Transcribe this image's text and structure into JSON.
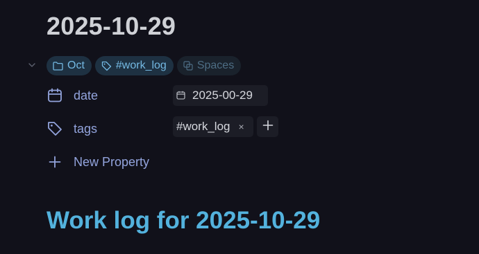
{
  "title": "2025-10-29",
  "chips": {
    "folder": "Oct",
    "tag": "#work_log",
    "spaces": "Spaces"
  },
  "properties": {
    "date": {
      "label": "date",
      "value": "2025-00-29"
    },
    "tags": {
      "label": "tags",
      "value": "#work_log",
      "remove": "×"
    },
    "new_property_label": "New Property"
  },
  "heading": "Work log for 2025-10-29",
  "icons": {
    "collapse": "chevron-down-icon",
    "folder": "folder-icon",
    "tag": "tag-icon",
    "spaces": "copy-icon",
    "date": "calendar-icon",
    "tags": "tag-icon",
    "add": "plus-icon"
  },
  "colors": {
    "background": "#11111a",
    "property_label": "#93a4dd",
    "heading": "#53b2dd",
    "chip": "#74b9e3"
  }
}
